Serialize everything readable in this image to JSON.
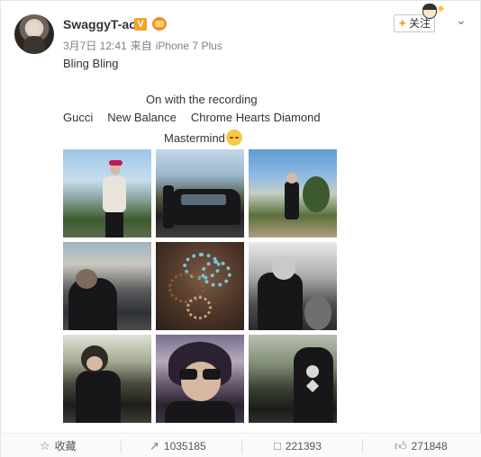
{
  "post": {
    "username": "SwaggyT-ao",
    "verified_badge": "V",
    "timestamp": "3月7日 12:41",
    "source_prefix": "来自",
    "source": "iPhone 7 Plus",
    "follow_label": "关注",
    "follow_plus": "+",
    "menu_icon": "chevron-down-icon",
    "lines": {
      "line1": "Bling Bling",
      "line2": "On with the recording",
      "brands": [
        "Gucci",
        "New Balance",
        "Chrome Hearts Diamond"
      ],
      "line4": "Mastermind"
    },
    "photos": [
      {
        "name": "photo-street-1"
      },
      {
        "name": "photo-suv"
      },
      {
        "name": "photo-street-2"
      },
      {
        "name": "photo-sunset"
      },
      {
        "name": "photo-bracelets"
      },
      {
        "name": "photo-bw-portrait"
      },
      {
        "name": "photo-selfie-1"
      },
      {
        "name": "photo-selfie-sunglasses"
      },
      {
        "name": "photo-mastermind-jacket"
      }
    ]
  },
  "footer": {
    "favorite_label": "收藏",
    "repost_count": "1035185",
    "comment_count": "221393",
    "like_count": "271848",
    "icons": {
      "favorite": "star-icon",
      "repost": "repost-icon",
      "comment": "comment-icon",
      "like": "thumbs-up-icon"
    }
  },
  "colors": {
    "accent": "#ff8200",
    "text": "#333333",
    "muted": "#808080"
  }
}
